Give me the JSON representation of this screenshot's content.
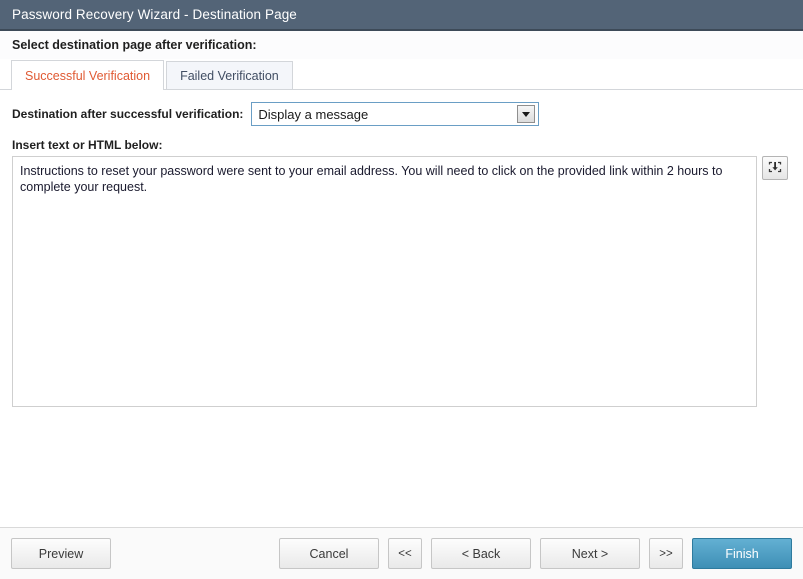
{
  "window": {
    "title": "Password Recovery Wizard - Destination Page"
  },
  "header": {
    "instruction": "Select destination page after verification:"
  },
  "tabs": [
    {
      "label": "Successful Verification",
      "active": true
    },
    {
      "label": "Failed Verification",
      "active": false
    }
  ],
  "destination": {
    "label": "Destination after successful verification:",
    "selected": "Display a message",
    "dropdown_icon": "chevron-down-icon"
  },
  "editor": {
    "label": "Insert text or HTML below:",
    "value": "Instructions to reset your password were sent to your email address. You will need to click on the provided link within 2 hours to complete your request.",
    "placeholder": "",
    "insert_button_icon": "insert-field-icon"
  },
  "footer": {
    "preview_label": "Preview",
    "cancel_label": "Cancel",
    "first_label": "<<",
    "back_label": "< Back",
    "next_label": "Next >",
    "last_label": ">>",
    "finish_label": "Finish"
  },
  "colors": {
    "titlebar_bg": "#536477",
    "active_tab_text": "#e05a33",
    "inactive_tab_text": "#414e63",
    "finish_button_bg": "#3e8fb5",
    "select_border": "#6a9ec5"
  }
}
